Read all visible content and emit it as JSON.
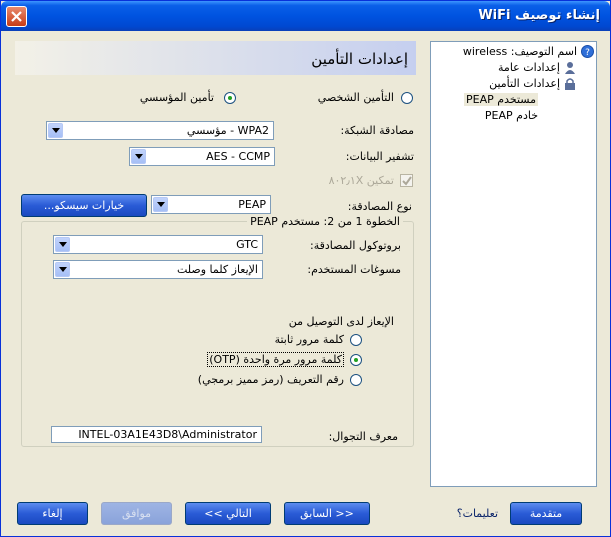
{
  "window": {
    "title": "إنشاء توصيف WiFi"
  },
  "header": {
    "title": "إعدادات التأمين"
  },
  "security_mode": {
    "personal_label": "التأمين الشخصي",
    "enterprise_label": "تأمين المؤسسي",
    "selected": "enterprise"
  },
  "network_auth": {
    "label": "مصادقة الشبكة:",
    "value": "WPA2 - مؤسسي"
  },
  "data_encryption": {
    "label": "تشفير البيانات:",
    "value": "AES - CCMP"
  },
  "enable_8021x": {
    "label": "تمكين ٨٠٢٫١X",
    "checked": true
  },
  "auth_type": {
    "label": "نوع المصادقة:",
    "value": "PEAP"
  },
  "cisco_button": {
    "label": "خيارات سيسكو..."
  },
  "group": {
    "legend": "الخطوة 1 من 2: مستخدم PEAP",
    "auth_protocol": {
      "label": "بروتوكول المصادقة:",
      "value": "GTC"
    },
    "user_credentials": {
      "label": "مسوغات المستخدم:",
      "value": "الإيعاز كلما وصلت"
    },
    "prompt_heading": "الإيعاز لدى التوصيل من",
    "options": [
      {
        "label": "كلمة مرور ثابتة",
        "selected": false
      },
      {
        "label": "كلمة مرور مرة واحدة (OTP)",
        "selected": true
      },
      {
        "label": "رقم التعريف (رمز مميز برمجي)",
        "selected": false
      }
    ],
    "roaming_id": {
      "label": "معرف التجوال:",
      "value": "INTEL-03A1E43D8\\Administrator"
    }
  },
  "tree": {
    "items": [
      {
        "label": "اسم التوصيف: wireless",
        "icon": "info-icon"
      },
      {
        "label": "إعدادات عامة",
        "icon": "user-icon"
      },
      {
        "label": "إعدادات التأمين",
        "icon": "lock-icon"
      },
      {
        "label": "مستخدم PEAP",
        "icon": ""
      },
      {
        "label": "خادم PEAP",
        "icon": ""
      }
    ]
  },
  "footer": {
    "advanced": "متقدمة",
    "help": "تعليمات؟",
    "back": "<< السابق",
    "next": "التالي >>",
    "ok": "موافق",
    "cancel": "إلغاء"
  },
  "colors": {
    "titlebar": "#0053E0",
    "accent_button": "#2A5BD6",
    "window_bg": "#ECE9D8"
  }
}
